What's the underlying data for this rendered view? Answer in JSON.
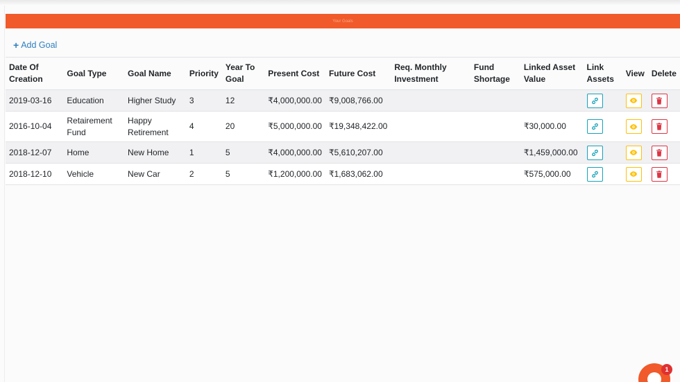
{
  "header_bar": {
    "text": "Your Goals"
  },
  "add_goal": {
    "label": "Add Goal"
  },
  "table": {
    "columns": [
      "Date Of Creation",
      "Goal Type",
      "Goal Name",
      "Priority",
      "Year To Goal",
      "Present Cost",
      "Future Cost",
      "Req. Monthly Investment",
      "Fund Shortage",
      "Linked Asset Value",
      "Link Assets",
      "View",
      "Delete"
    ],
    "rows": [
      {
        "date": "2019-03-16",
        "type": "Education",
        "name": "Higher Study",
        "priority": "3",
        "years": "12",
        "present": "₹4,000,000.00",
        "future": "₹9,008,766.00",
        "monthly": "",
        "shortage": "",
        "linked": ""
      },
      {
        "date": "2016-10-04",
        "type": "Retairement Fund",
        "name": "Happy Retirement",
        "priority": "4",
        "years": "20",
        "present": "₹5,000,000.00",
        "future": "₹19,348,422.00",
        "monthly": "",
        "shortage": "",
        "linked": "₹30,000.00"
      },
      {
        "date": "2018-12-07",
        "type": "Home",
        "name": "New Home",
        "priority": "1",
        "years": "5",
        "present": "₹4,000,000.00",
        "future": "₹5,610,207.00",
        "monthly": "",
        "shortage": "",
        "linked": "₹1,459,000.00"
      },
      {
        "date": "2018-12-10",
        "type": "Vehicle",
        "name": "New Car",
        "priority": "2",
        "years": "5",
        "present": "₹1,200,000.00",
        "future": "₹1,683,062.00",
        "monthly": "",
        "shortage": "",
        "linked": "₹575,000.00"
      }
    ]
  },
  "chat": {
    "badge_count": "1"
  },
  "colors": {
    "accent": "#f15a2a",
    "link": "#2f7fc1",
    "info": "#17a2b8",
    "warning": "#ffc107",
    "danger": "#dc3545"
  },
  "icons": {
    "add": "plus-icon",
    "link": "link-icon",
    "view": "eye-icon",
    "delete": "trash-icon"
  }
}
